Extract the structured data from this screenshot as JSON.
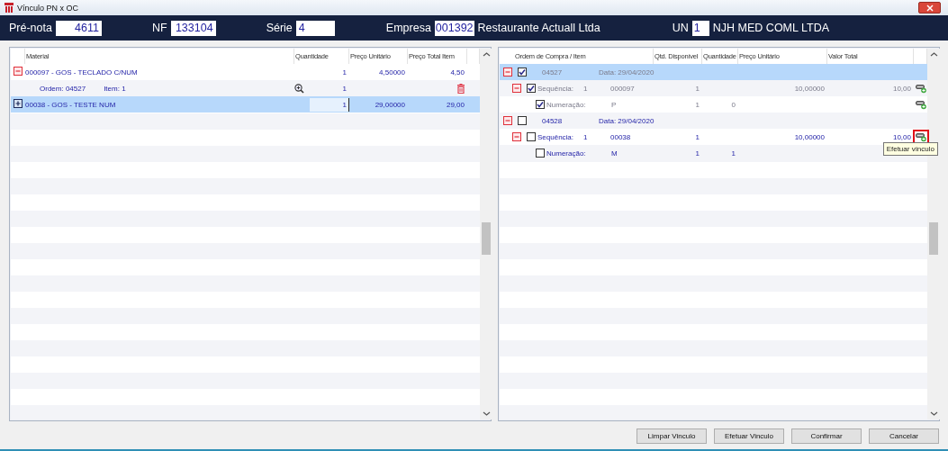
{
  "window": {
    "title": "Vínculo PN x OC"
  },
  "header": {
    "fields": [
      {
        "label": "Pré-nota",
        "value": "4611"
      },
      {
        "label": "NF",
        "value": "133104"
      },
      {
        "label": "Série",
        "value": "4"
      },
      {
        "label": "Empresa",
        "value": "001392",
        "description": "Restaurante Actuall Ltda"
      },
      {
        "label": "UN",
        "value": "1",
        "description": "NJH MED COML LTDA"
      }
    ]
  },
  "materials": {
    "columns": [
      "Material",
      "Quantidade",
      "Preço Unitário",
      "Preço Total Item"
    ],
    "rows": [
      {
        "kind": "material",
        "expanded": true,
        "selected": false,
        "material": "000097 - GOS - TECLADO C/NUM",
        "quantidade": "1",
        "preco_unitario": "4,50000",
        "preco_total": "4,50"
      },
      {
        "kind": "order",
        "ordem": "Ordem: 04527",
        "item": "Item: 1",
        "quantidade": "1"
      },
      {
        "kind": "material",
        "expanded": false,
        "selected": true,
        "editing": true,
        "material": "00038 - GOS - TESTE NUM",
        "quantidade": "1",
        "preco_unitario": "29,00000",
        "preco_total": "29,00"
      }
    ]
  },
  "orders": {
    "columns": [
      "Ordem de Compra / Item",
      "Qtd. Disponível",
      "Quantidade",
      "Preço Unitário",
      "Valor Total"
    ],
    "rows": [
      {
        "kind": "order",
        "expanded": true,
        "checked": true,
        "selected": true,
        "disabled": true,
        "number": "04527",
        "date": "Data: 29/04/2020",
        "children": [
          {
            "kind": "sequence",
            "expanded": true,
            "checked": true,
            "disabled": true,
            "label": "Sequência:",
            "seq": "1",
            "code": "000097",
            "qtd_disponivel": "1",
            "preco_unitario": "10,00000",
            "valor_total": "10,00",
            "linkable": true,
            "highlighted": false,
            "children": [
              {
                "kind": "numeracao",
                "checked": true,
                "disabled": true,
                "label": "Numeração:",
                "code": "P",
                "qtd_disponivel": "1",
                "quantidade": "0",
                "linkable": true
              }
            ]
          }
        ]
      },
      {
        "kind": "order",
        "expanded": true,
        "checked": false,
        "selected": false,
        "disabled": false,
        "number": "04528",
        "date": "Data: 29/04/2020",
        "children": [
          {
            "kind": "sequence",
            "expanded": true,
            "checked": false,
            "disabled": false,
            "label": "Sequência:",
            "seq": "1",
            "code": "00038",
            "qtd_disponivel": "1",
            "preco_unitario": "10,00000",
            "valor_total": "10,00",
            "linkable": true,
            "highlighted": true,
            "tooltip": "Efetuar vínculo",
            "children": [
              {
                "kind": "numeracao",
                "checked": false,
                "disabled": false,
                "label": "Numeração:",
                "code": "M",
                "qtd_disponivel": "1",
                "quantidade": "1"
              }
            ]
          }
        ]
      }
    ]
  },
  "buttons": [
    "Limpar Vinculo",
    "Efetuar Vinculo",
    "Confirmar",
    "Cancelar"
  ]
}
